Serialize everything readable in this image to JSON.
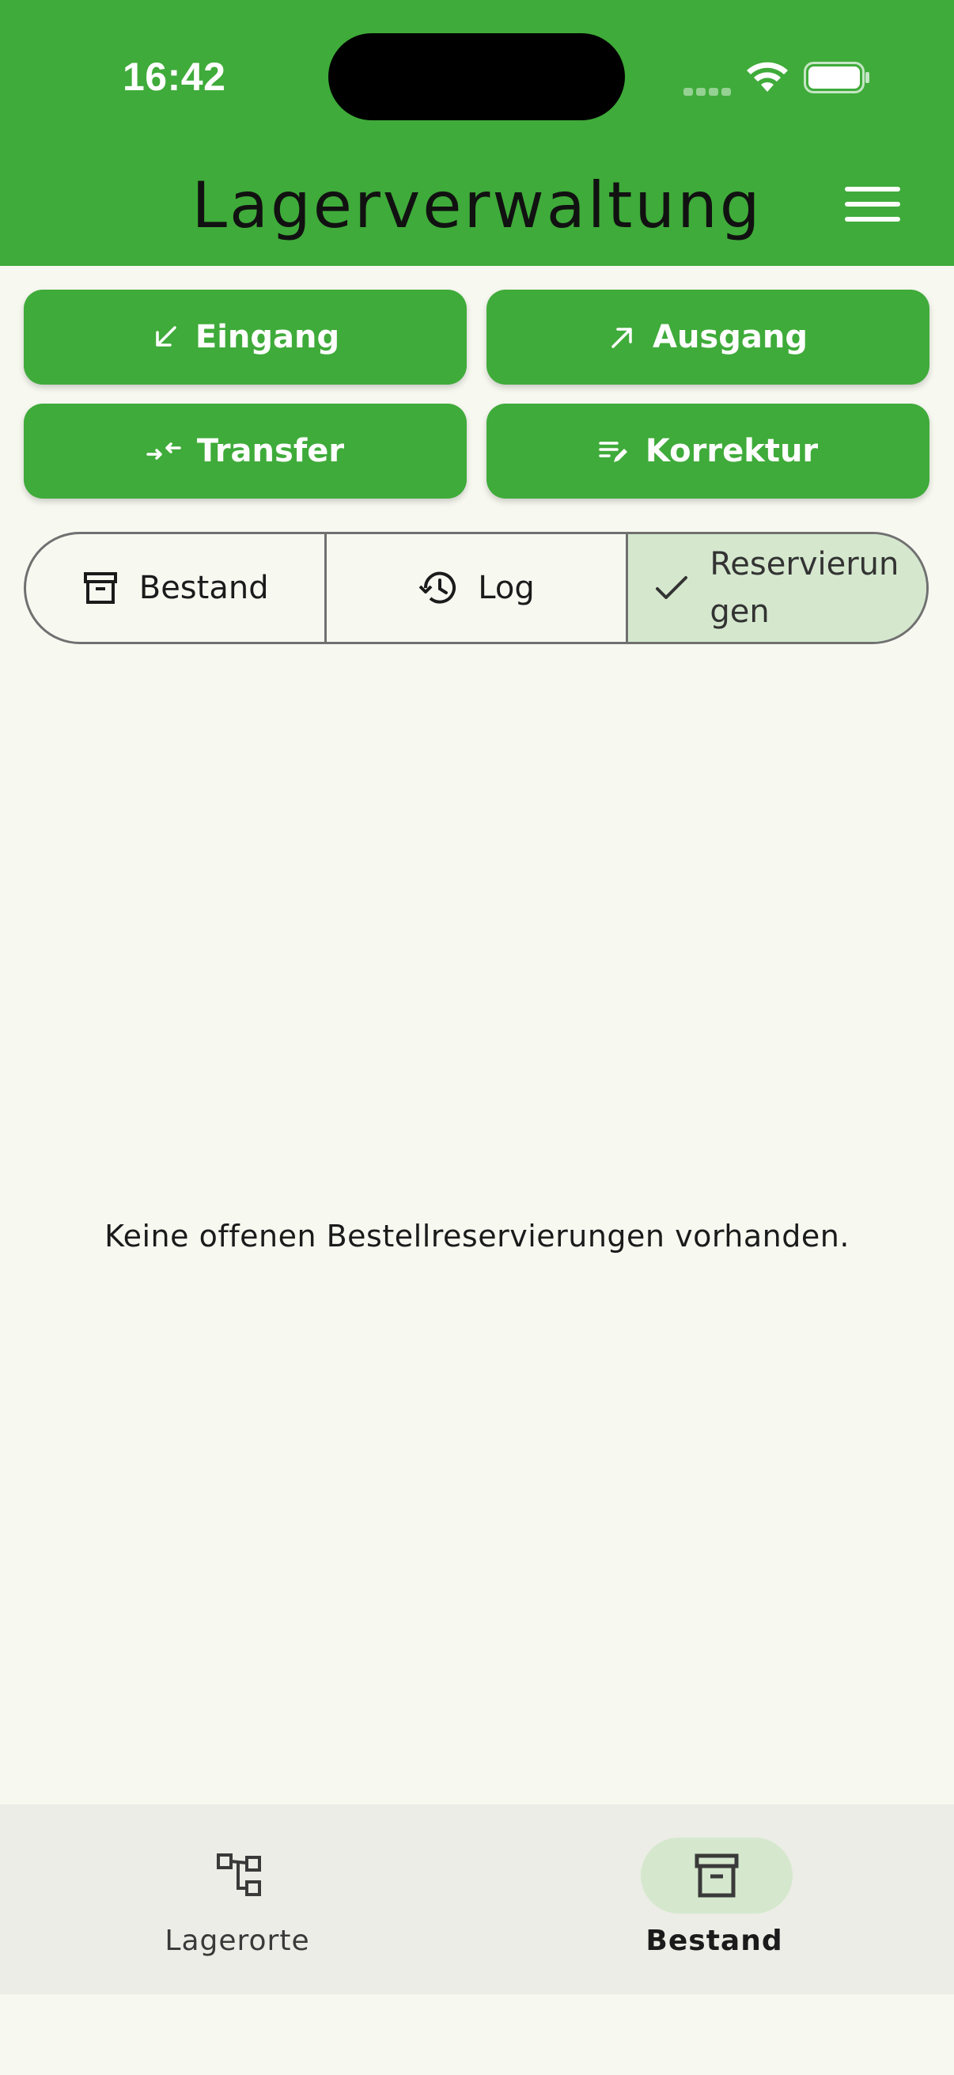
{
  "status_bar": {
    "time": "16:42"
  },
  "app_bar": {
    "title": "Lagerverwaltung",
    "menu_icon": "hamburger-menu-icon"
  },
  "actions": [
    {
      "label": "Eingang",
      "icon": "arrow-down-left-icon"
    },
    {
      "label": "Ausgang",
      "icon": "arrow-up-right-icon"
    },
    {
      "label": "Transfer",
      "icon": "transfer-arrows-icon"
    },
    {
      "label": "Korrektur",
      "icon": "edit-list-icon"
    }
  ],
  "segments": [
    {
      "label": "Bestand",
      "icon": "archive-box-icon",
      "selected": false
    },
    {
      "label": "Log",
      "icon": "history-icon",
      "selected": false
    },
    {
      "label": "Reservierungen",
      "icon": "check-icon",
      "selected": true
    }
  ],
  "empty_state": {
    "message": "Keine offenen Bestellreservierungen vorhanden."
  },
  "bottom_nav": [
    {
      "label": "Lagerorte",
      "icon": "hierarchy-icon",
      "active": false
    },
    {
      "label": "Bestand",
      "icon": "archive-box-icon",
      "active": true
    }
  ],
  "colors": {
    "primary": "#3fab3a",
    "background": "#f7f9f1",
    "selected": "#d5e8ce",
    "nav_bg": "#ecede6"
  }
}
